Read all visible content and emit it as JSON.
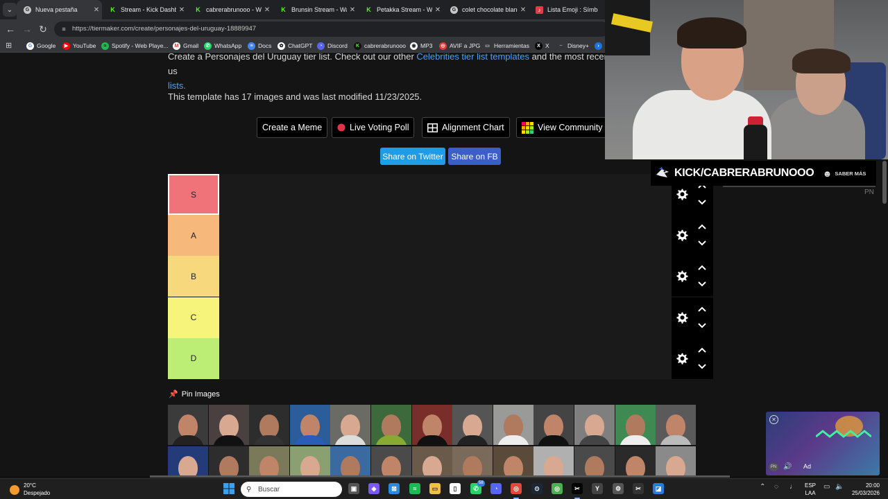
{
  "browser": {
    "tabs": [
      {
        "title": "Nueva pestaña",
        "favicon": "chrome-icon"
      },
      {
        "title": "Stream - Kick Dashbo",
        "favicon": "kick-icon"
      },
      {
        "title": "cabrerabrunooo - Wa",
        "favicon": "kick-icon"
      },
      {
        "title": "Brunsin Stream - Wat",
        "favicon": "kick-icon"
      },
      {
        "title": "Petakka Stream - Wa",
        "favicon": "kick-icon"
      },
      {
        "title": "colet chocolate blanc",
        "favicon": "google-icon"
      },
      {
        "title": "Lista Emoji : Símbolo",
        "favicon": "emoji-icon"
      }
    ],
    "url": "https://tiermaker.com/create/personajes-del-uruguay-18889947",
    "bookmarks": [
      "Google",
      "YouTube",
      "Spotify - Web Playe...",
      "Gmail",
      "WhatsApp",
      "Docs",
      "ChatGPT",
      "Discord",
      "cabrerabrunooo",
      "MP3",
      "AVIF a JPG",
      "Herramientas",
      "X",
      "Disney+"
    ]
  },
  "page": {
    "desc_start": "Create a Personajes del Uruguay tier list. Check out our other ",
    "desc_link": "Celebrities tier list templates",
    "desc_mid": " and the most recent us",
    "desc_end": "lists.",
    "template_info": "This template has 17 images and was last modified 11/23/2025.",
    "buttons": {
      "meme": "Create a Meme",
      "poll": "Live Voting Poll",
      "alignment": "Alignment Chart",
      "community": "View Community R"
    },
    "share": {
      "twitter": "Share on Twitter",
      "fb": "Share on FB"
    },
    "tiers": [
      {
        "label": "S",
        "color": "#f0737a"
      },
      {
        "label": "A",
        "color": "#f7b97b"
      },
      {
        "label": "B",
        "color": "#f7d87c"
      },
      {
        "label": "C",
        "color": "#f7f47c"
      },
      {
        "label": "D",
        "color": "#bcee76"
      }
    ],
    "pin_label": "Pin Images",
    "image_count": 26
  },
  "overlay": {
    "kick_text": "KICK/CABRERABRUNOOO",
    "saber": "SABER MÁS",
    "pn": "PN",
    "ad_label": "Ad",
    "ad_pn": "PN"
  },
  "taskbar": {
    "temp": "20°C",
    "weather": "Despejado",
    "search": "Buscar",
    "lang1": "ESP",
    "lang2": "LAA",
    "time": "20:00",
    "date": "25/03/2026",
    "badge_whatsapp": "58"
  }
}
